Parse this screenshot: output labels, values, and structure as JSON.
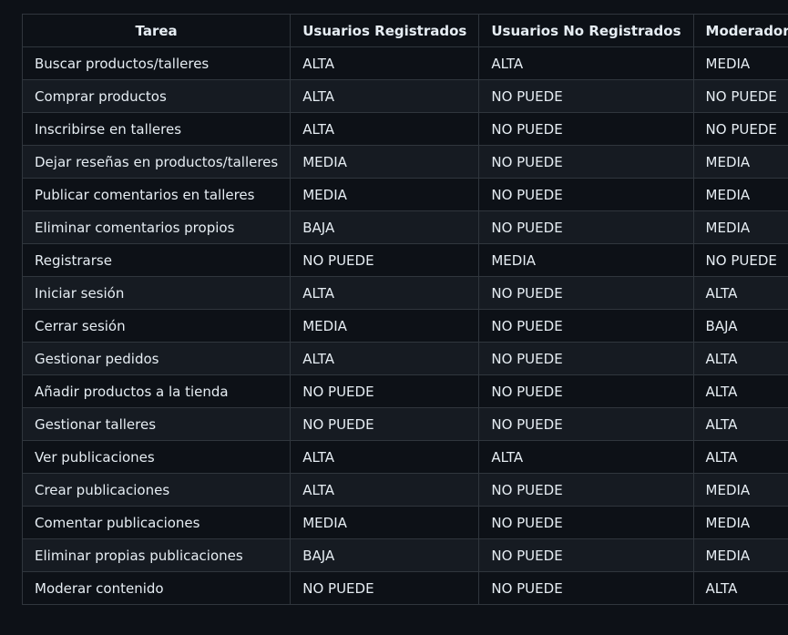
{
  "table": {
    "headers": [
      "Tarea",
      "Usuarios Registrados",
      "Usuarios No Registrados",
      "Moderador"
    ],
    "rows": [
      [
        "Buscar productos/talleres",
        "ALTA",
        "ALTA",
        "MEDIA"
      ],
      [
        "Comprar productos",
        "ALTA",
        "NO PUEDE",
        "NO PUEDE"
      ],
      [
        "Inscribirse en talleres",
        "ALTA",
        "NO PUEDE",
        "NO PUEDE"
      ],
      [
        "Dejar reseñas en productos/talleres",
        "MEDIA",
        "NO PUEDE",
        "MEDIA"
      ],
      [
        "Publicar comentarios en talleres",
        "MEDIA",
        "NO PUEDE",
        "MEDIA"
      ],
      [
        "Eliminar comentarios propios",
        "BAJA",
        "NO PUEDE",
        "MEDIA"
      ],
      [
        "Registrarse",
        "NO PUEDE",
        "MEDIA",
        "NO PUEDE"
      ],
      [
        "Iniciar sesión",
        "ALTA",
        "NO PUEDE",
        "ALTA"
      ],
      [
        "Cerrar sesión",
        "MEDIA",
        "NO PUEDE",
        "BAJA"
      ],
      [
        "Gestionar pedidos",
        "ALTA",
        "NO PUEDE",
        "ALTA"
      ],
      [
        "Añadir productos a la tienda",
        "NO PUEDE",
        "NO PUEDE",
        "ALTA"
      ],
      [
        "Gestionar talleres",
        "NO PUEDE",
        "NO PUEDE",
        "ALTA"
      ],
      [
        "Ver publicaciones",
        "ALTA",
        "ALTA",
        "ALTA"
      ],
      [
        "Crear publicaciones",
        "ALTA",
        "NO PUEDE",
        "MEDIA"
      ],
      [
        "Comentar publicaciones",
        "MEDIA",
        "NO PUEDE",
        "MEDIA"
      ],
      [
        "Eliminar propias publicaciones",
        "BAJA",
        "NO PUEDE",
        "MEDIA"
      ],
      [
        "Moderar contenido",
        "NO PUEDE",
        "NO PUEDE",
        "ALTA"
      ]
    ]
  },
  "colors": {
    "background": "#0d1117",
    "row_alt": "#161b22",
    "border": "#30363d",
    "text": "#e6edf3"
  }
}
